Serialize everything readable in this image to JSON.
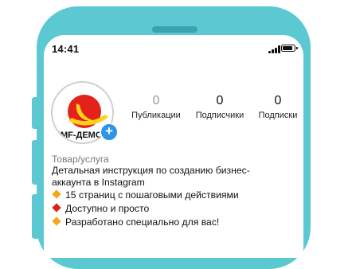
{
  "status_bar": {
    "time": "14:41"
  },
  "profile": {
    "avatar_label": "KMF-ДЕМО",
    "stats": [
      {
        "value": "0",
        "label": "Публикации"
      },
      {
        "value": "0",
        "label": "Подписчики"
      },
      {
        "value": "0",
        "label": "Подписки"
      }
    ],
    "category": "Товар/услуга",
    "bio_lines": [
      "Детальная инструкция по созданию бизнес-",
      "аккаунта в Instagram"
    ],
    "bullets": [
      {
        "text": "15 страниц с пошаговыми действиями",
        "color": "#f4a61d"
      },
      {
        "text": "Доступно и просто",
        "color": "#e0201b"
      },
      {
        "text": "Разработано специально для вас!",
        "color": "#f4a61d"
      }
    ]
  },
  "colors": {
    "phone_frame": "#5bc8d2",
    "add_button": "#2f93e8"
  }
}
